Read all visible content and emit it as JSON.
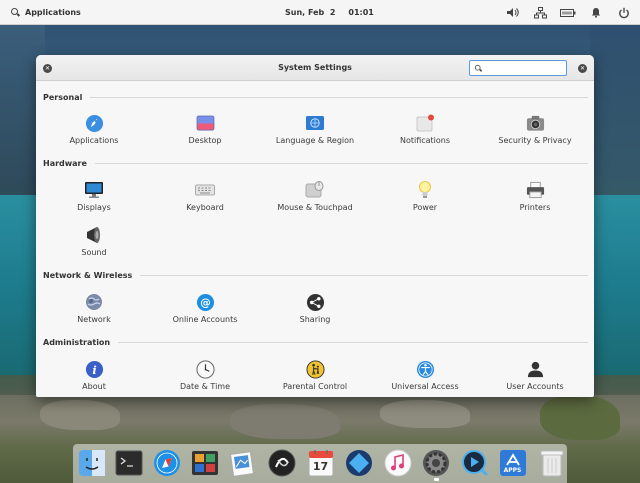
{
  "panel": {
    "applications_label": "Applications",
    "date": "Sun, Feb  2",
    "time": "01:01",
    "indicators": [
      "volume-icon",
      "network-icon",
      "battery-icon",
      "notifications-icon",
      "power-icon"
    ]
  },
  "window": {
    "title": "System Settings",
    "search_value": "",
    "search_placeholder": ""
  },
  "sections": {
    "personal": {
      "title": "Personal",
      "items": [
        {
          "label": "Applications",
          "icon": "applications-icon"
        },
        {
          "label": "Desktop",
          "icon": "desktop-icon"
        },
        {
          "label": "Language & Region",
          "icon": "language-region-icon"
        },
        {
          "label": "Notifications",
          "icon": "notifications-icon"
        },
        {
          "label": "Security & Privacy",
          "icon": "security-privacy-icon"
        }
      ]
    },
    "hardware": {
      "title": "Hardware",
      "items": [
        {
          "label": "Displays",
          "icon": "displays-icon"
        },
        {
          "label": "Keyboard",
          "icon": "keyboard-icon"
        },
        {
          "label": "Mouse & Touchpad",
          "icon": "mouse-touchpad-icon"
        },
        {
          "label": "Power",
          "icon": "power-icon"
        },
        {
          "label": "Printers",
          "icon": "printers-icon"
        },
        {
          "label": "Sound",
          "icon": "sound-icon"
        }
      ]
    },
    "network": {
      "title": "Network & Wireless",
      "items": [
        {
          "label": "Network",
          "icon": "network-icon"
        },
        {
          "label": "Online Accounts",
          "icon": "online-accounts-icon"
        },
        {
          "label": "Sharing",
          "icon": "sharing-icon"
        }
      ]
    },
    "administration": {
      "title": "Administration",
      "items": [
        {
          "label": "About",
          "icon": "about-icon"
        },
        {
          "label": "Date & Time",
          "icon": "date-time-icon"
        },
        {
          "label": "Parental Control",
          "icon": "parental-control-icon"
        },
        {
          "label": "Universal Access",
          "icon": "universal-access-icon"
        },
        {
          "label": "User Accounts",
          "icon": "user-accounts-icon"
        }
      ]
    }
  },
  "dock": {
    "items": [
      {
        "icon": "files-icon"
      },
      {
        "icon": "terminal-icon"
      },
      {
        "icon": "browser-icon"
      },
      {
        "icon": "photo-viewer-icon"
      },
      {
        "icon": "image-editor-icon"
      },
      {
        "icon": "media-app-icon"
      },
      {
        "icon": "calendar-icon",
        "text": "17"
      },
      {
        "icon": "media-center-icon"
      },
      {
        "icon": "music-icon"
      },
      {
        "icon": "system-settings-icon"
      },
      {
        "icon": "video-player-icon"
      },
      {
        "icon": "app-store-icon",
        "text": "APPS"
      },
      {
        "icon": "trash-icon"
      }
    ]
  }
}
